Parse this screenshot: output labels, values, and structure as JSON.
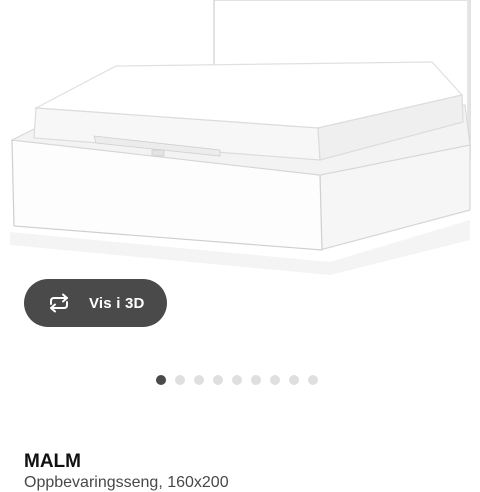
{
  "product": {
    "image_alt": "",
    "view_3d_label": "Vis i 3D",
    "view_3d_icon": "rotate-arrows-icon",
    "name": "MALM",
    "description": "Oppbevaringsseng, 160x200"
  },
  "carousel": {
    "total": 9,
    "active_index": 0,
    "active_color": "#4a4a4a",
    "inactive_color": "#dfdfdf"
  }
}
